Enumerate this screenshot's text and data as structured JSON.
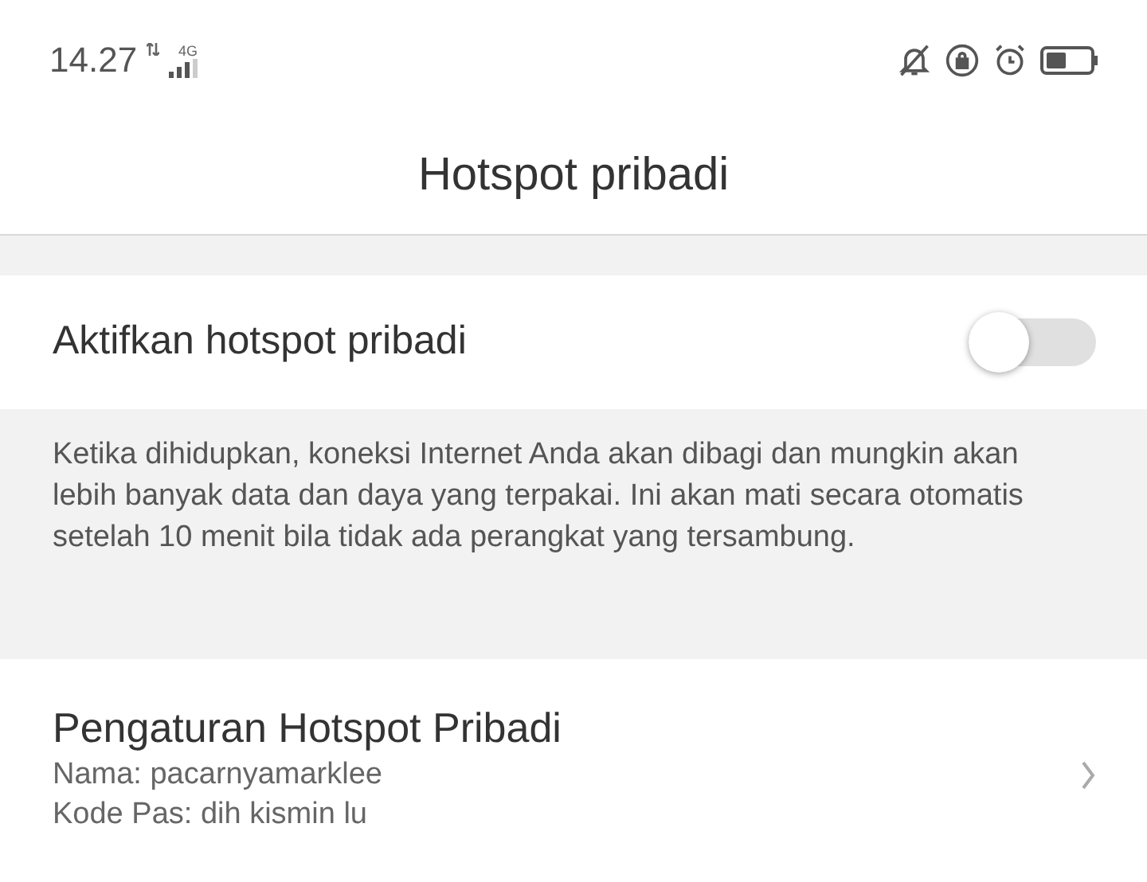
{
  "status_bar": {
    "time": "14.27",
    "network": "4G"
  },
  "header": {
    "title": "Hotspot pribadi"
  },
  "toggle_row": {
    "label": "Aktifkan hotspot pribadi",
    "on": false
  },
  "description": "Ketika dihidupkan, koneksi Internet Anda akan dibagi dan mungkin akan lebih banyak data dan daya yang terpakai. Ini akan mati secara otomatis setelah 10 menit bila tidak ada perangkat yang tersambung.",
  "settings_row": {
    "title": "Pengaturan Hotspot Pribadi",
    "lines": [
      "Nama: pacarnyamarklee",
      "Kode Pas: dih kismin lu"
    ]
  }
}
